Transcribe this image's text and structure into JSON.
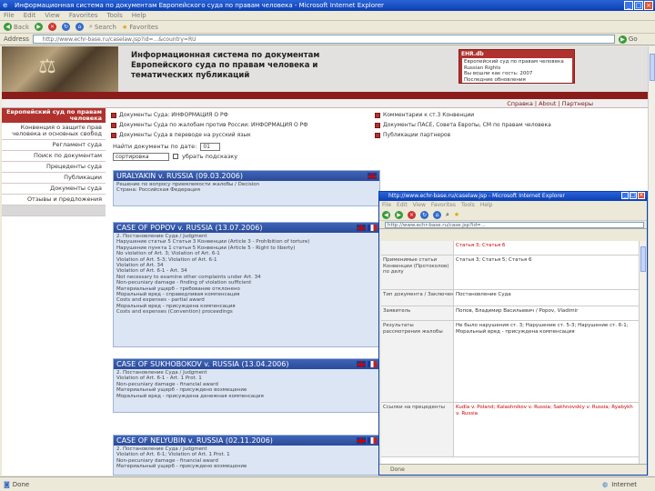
{
  "window": {
    "title": "Информационная система по документам Европейского суда по правам человека - Microsoft Internet Explorer",
    "menu": [
      "File",
      "Edit",
      "View",
      "Favorites",
      "Tools",
      "Help"
    ],
    "toolbar": {
      "back": "Back",
      "search": "Search",
      "favorites": "Favorites"
    },
    "address_label": "Address",
    "address": "http://www.echr-base.ru/caselaw.jsp?id=...&country=RU",
    "go": "Go",
    "status_left": "Done",
    "status_zone": "Internet"
  },
  "site": {
    "title": "Информационная система по документам Европейского суда по правам человека и тематических публикаций",
    "login_logo": "EHR.db",
    "news_lines": [
      "Европейский суд по правам человека",
      "Russian Rights",
      "Вы вошли как гость: 2007",
      "Последние обновления"
    ],
    "toplinks": "Справка | About | Партнеры"
  },
  "sidebar": {
    "head": "Европейский суд по правам человека",
    "items": [
      "Конвенция о защите прав человека и основных свобод",
      "Регламент суда",
      "Поиск по документам",
      "Прецеденты суда",
      "Публикации",
      "Документы суда",
      "Отзывы и предложения"
    ]
  },
  "categories": [
    [
      "Документы Суда: ИНФОРМАЦИЯ О РФ",
      "Комментарии к ст.3 Конвенции"
    ],
    [
      "Документы Суда по жалобам против России: ИНФОРМАЦИЯ О РФ",
      "Документы ПАСЕ, Совета Европы, СМ по правам человека"
    ],
    [
      "Документы Суда в переводе на русский язык",
      "Публикации партнеров"
    ]
  ],
  "search": {
    "label": "Найти документы по дате:",
    "day": "01",
    "sort": "сортировка",
    "hide_label": "убрать подсказку"
  },
  "cases": [
    {
      "title": "URALYAKIN v. RUSSIA (09.03.2006)",
      "lines": [
        "Решение по вопросу приемлемости жалобы / Decision",
        "Страна: Российская Федерация"
      ]
    },
    {
      "title": "CASE OF POPOV v. RUSSIA (13.07.2006)",
      "lines": [
        "2. Постановление Суда / Judgment",
        "Нарушение статьи 5 Статьи 3 Конвенции (Article 3 - Prohibition of torture)",
        "Нарушение пункта 1 статьи 5 Конвенции (Article 5 - Right to liberty)",
        "No violation of Art. 3; Violation of Art. 6-1",
        "Violation of Art. 5-3; Violation of Art. 6-1",
        "Violation of Art. 34",
        "Violation of Art. 6-1 - Art. 34",
        "Not necessary to examine other complaints under Art. 34",
        "Non-pecuniary damage - finding of violation sufficient",
        "Материальный ущерб - требование отклонено",
        "Моральный вред - справедливая компенсация",
        "Costs and expenses - partial award",
        "Моральный вред - присуждена компенсация",
        "Costs and expenses (Convention) proceedings"
      ]
    },
    {
      "title": "CASE OF SUKHOBOKOV v. RUSSIA (13.04.2006)",
      "lines": [
        "2. Постановление Суда / Judgment",
        "Violation of Art. 6-1 - Art. 1 Prot. 1",
        "Non-pecuniary damage - financial award",
        "Материальный ущерб - присуждено возмещение",
        "Моральный вред - присуждена денежная компенсация"
      ]
    },
    {
      "title": "CASE OF NELYUBIN v. RUSSIA (02.11.2006)",
      "lines": [
        "2. Постановление Суда / Judgment",
        "Violation of Art. 6-1; Violation of Art. 1 Prot. 1",
        "Non-pecuniary damage - financial award",
        "Материальный ущерб - присуждено возмещение"
      ]
    }
  ],
  "popup": {
    "title": "http://www.echr-base.ru/caselaw.jsp - Microsoft Internet Explorer",
    "menu": [
      "File",
      "Edit",
      "View",
      "Favorites",
      "Tools",
      "Help"
    ],
    "address": "http://www.echr-base.ru/case.jsp?id=...",
    "status": "Done",
    "rows": [
      {
        "label": "",
        "value": "Статья 3; Статья 6",
        "red": true
      },
      {
        "label": "Применимые статьи Конвенции (Протоколов) по делу",
        "value": "Статья 3; Статья 5; Статья 6",
        "red": false
      },
      {
        "label": "Тип документа / Заключение",
        "value": "Постановление Суда",
        "red": false
      },
      {
        "label": "Заявитель",
        "value": "Попов, Владимир Васильевич / Popov, Vladimir",
        "red": false
      },
      {
        "label": "Результаты рассмотрения жалобы",
        "value": "Не было нарушения ст. 3; Нарушение ст. 5-3; Нарушение ст. 6-1; Моральный вред - присуждена компенсация",
        "red": false
      },
      {
        "label": "Ссылки на прецеденты",
        "value": "Kudla v. Poland; Kalashnikov v. Russia; Sakhnovskiy v. Russia; Ryabykh v. Russia",
        "red": true
      }
    ]
  }
}
